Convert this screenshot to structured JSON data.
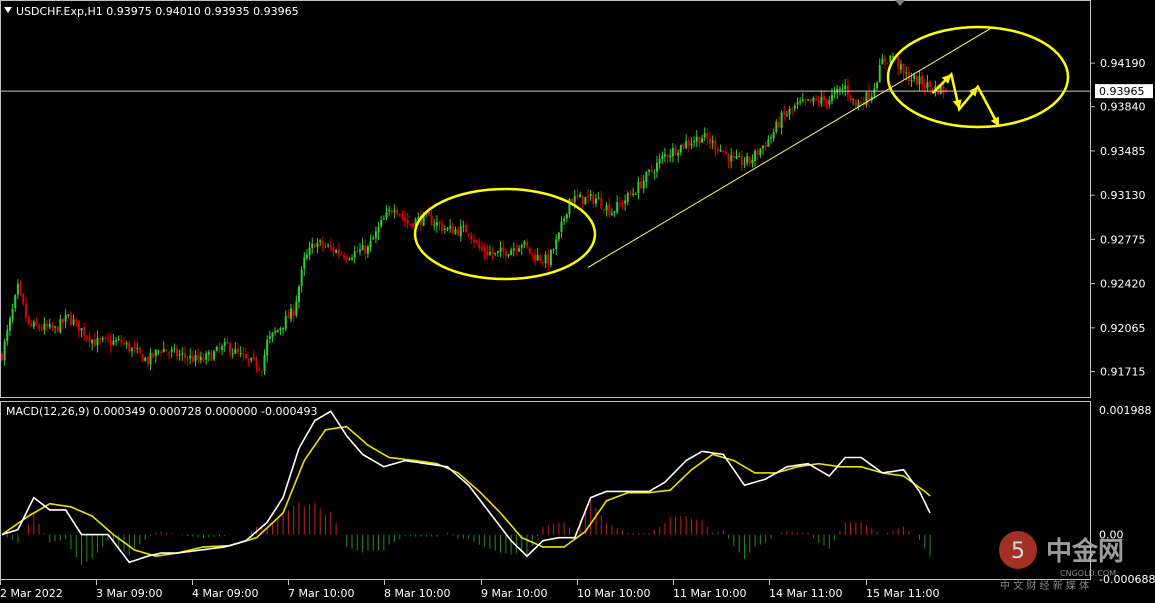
{
  "window": {
    "symbol_line": "USDCHF.Exp,H1  0.93975 0.94010 0.93935 0.93965",
    "menu_icon": "triangle-down-icon"
  },
  "price_panel": {
    "current_price_label": "0.93965",
    "y_ticks": [
      "0.94190",
      "0.93840",
      "0.93485",
      "0.93130",
      "0.92775",
      "0.92420",
      "0.92065",
      "0.91715"
    ]
  },
  "macd_panel": {
    "label": "MACD(12,26,9) 0.000349 0.000728 0.000000 -0.000493",
    "y_ticks": [
      "0.001988",
      "0.00",
      "-0.000688"
    ]
  },
  "x_ticks": [
    "2 Mar 2022",
    "3 Mar 09:00",
    "4 Mar 09:00",
    "7 Mar 10:00",
    "8 Mar 10:00",
    "9 Mar 10:00",
    "10 Mar 10:00",
    "11 Mar 10:00",
    "14 Mar 11:00",
    "15 Mar 11:00"
  ],
  "watermark": {
    "brand_cn": "中金网",
    "brand_en": "CNGOLD.COM",
    "tagline": "中 文 财 经 新 媒 体"
  },
  "colors": {
    "background": "#000000",
    "bull": "#32cd32",
    "bear": "#e00000",
    "macd_main": "#ffffff",
    "macd_signal": "#f0e000",
    "annotation": "#ffff00",
    "grid_border": "#c0c0c0",
    "watermark_red": "#c0392b"
  },
  "chart_data": [
    {
      "type": "candlestick",
      "title": "USDCHF.Exp,H1",
      "timeframe": "H1",
      "last_bar": {
        "open": 0.93975,
        "high": 0.9401,
        "low": 0.93935,
        "close": 0.93965
      },
      "current_price": 0.93965,
      "ylim": [
        0.9155,
        0.9452
      ],
      "y_ticks": [
        0.9419,
        0.9384,
        0.93485,
        0.9313,
        0.92775,
        0.9242,
        0.92065,
        0.91715
      ],
      "x_ticks": [
        "2 Mar 2022",
        "3 Mar 09:00",
        "4 Mar 09:00",
        "7 Mar 10:00",
        "8 Mar 10:00",
        "9 Mar 10:00",
        "10 Mar 10:00",
        "11 Mar 10:00",
        "14 Mar 11:00",
        "15 Mar 11:00"
      ],
      "path_close": [
        [
          0,
          0.9185
        ],
        [
          4,
          0.922
        ],
        [
          6,
          0.9238
        ],
        [
          10,
          0.9208
        ],
        [
          20,
          0.9205
        ],
        [
          25,
          0.9215
        ],
        [
          35,
          0.9195
        ],
        [
          45,
          0.9195
        ],
        [
          55,
          0.918
        ],
        [
          60,
          0.919
        ],
        [
          66,
          0.9185
        ],
        [
          75,
          0.918
        ],
        [
          85,
          0.9192
        ],
        [
          92,
          0.918
        ],
        [
          98,
          0.9175
        ],
        [
          100,
          0.9195
        ],
        [
          104,
          0.9205
        ],
        [
          110,
          0.922
        ],
        [
          114,
          0.926
        ],
        [
          118,
          0.9275
        ],
        [
          130,
          0.9265
        ],
        [
          138,
          0.927
        ],
        [
          143,
          0.929
        ],
        [
          148,
          0.9305
        ],
        [
          153,
          0.929
        ],
        [
          160,
          0.9295
        ],
        [
          168,
          0.9285
        ],
        [
          176,
          0.9285
        ],
        [
          180,
          0.927
        ],
        [
          186,
          0.9265
        ],
        [
          192,
          0.927
        ],
        [
          196,
          0.9275
        ],
        [
          200,
          0.9265
        ],
        [
          206,
          0.926
        ],
        [
          210,
          0.928
        ],
        [
          214,
          0.931
        ],
        [
          224,
          0.931
        ],
        [
          230,
          0.93
        ],
        [
          238,
          0.9315
        ],
        [
          244,
          0.933
        ],
        [
          250,
          0.9345
        ],
        [
          258,
          0.9355
        ],
        [
          264,
          0.936
        ],
        [
          270,
          0.9352
        ],
        [
          276,
          0.934
        ],
        [
          282,
          0.934
        ],
        [
          290,
          0.936
        ],
        [
          294,
          0.9375
        ],
        [
          300,
          0.9385
        ],
        [
          306,
          0.9388
        ],
        [
          312,
          0.939
        ],
        [
          318,
          0.94
        ],
        [
          322,
          0.9385
        ],
        [
          328,
          0.9395
        ],
        [
          332,
          0.942
        ],
        [
          336,
          0.9425
        ],
        [
          340,
          0.941
        ],
        [
          345,
          0.9405
        ],
        [
          350,
          0.94
        ],
        [
          356,
          0.93965
        ]
      ],
      "bars": 357,
      "trendline": {
        "from": [
          221,
          0.9255
        ],
        "to": [
          373,
          0.9447
        ]
      },
      "annotations": {
        "ellipses": 3,
        "projected_path": [
          [
            351,
            0.9395
          ],
          [
            358,
            0.941
          ],
          [
            361,
            0.9382
          ],
          [
            368,
            0.94
          ],
          [
            376,
            0.9368
          ]
        ]
      }
    },
    {
      "type": "macd",
      "label": "MACD(12,26,9)",
      "values": {
        "main": 0.000349,
        "signal": 0.000728,
        "v3": 0.0,
        "v4": -0.000493
      },
      "ylim": [
        -0.000688,
        0.001988
      ],
      "y_ticks": [
        0.001988,
        0.0,
        -0.000688
      ],
      "main_path": [
        [
          0,
          0.0
        ],
        [
          6,
          8e-05
        ],
        [
          12,
          0.0006
        ],
        [
          18,
          0.0004
        ],
        [
          24,
          0.0004
        ],
        [
          30,
          0.0
        ],
        [
          40,
          0.0
        ],
        [
          48,
          -0.00045
        ],
        [
          55,
          -0.00035
        ],
        [
          60,
          -0.0003
        ],
        [
          66,
          -0.0003
        ],
        [
          75,
          -0.00025
        ],
        [
          84,
          -0.0002
        ],
        [
          92,
          -0.0001
        ],
        [
          100,
          0.0002
        ],
        [
          106,
          0.0006
        ],
        [
          112,
          0.0014
        ],
        [
          118,
          0.00185
        ],
        [
          124,
          0.002
        ],
        [
          130,
          0.0016
        ],
        [
          136,
          0.0013
        ],
        [
          144,
          0.0011
        ],
        [
          152,
          0.0012
        ],
        [
          160,
          0.00115
        ],
        [
          168,
          0.0011
        ],
        [
          176,
          0.0008
        ],
        [
          184,
          0.00035
        ],
        [
          192,
          -0.0001
        ],
        [
          198,
          -0.00035
        ],
        [
          204,
          -0.0001
        ],
        [
          210,
          -5e-05
        ],
        [
          216,
          -5e-05
        ],
        [
          222,
          0.0006
        ],
        [
          228,
          0.0007
        ],
        [
          236,
          0.0007
        ],
        [
          244,
          0.0007
        ],
        [
          250,
          0.00085
        ],
        [
          258,
          0.0012
        ],
        [
          264,
          0.00135
        ],
        [
          272,
          0.0013
        ],
        [
          280,
          0.0008
        ],
        [
          288,
          0.0009
        ],
        [
          296,
          0.0011
        ],
        [
          304,
          0.00115
        ],
        [
          312,
          0.00095
        ],
        [
          318,
          0.00125
        ],
        [
          324,
          0.00125
        ],
        [
          332,
          0.001
        ],
        [
          340,
          0.00105
        ],
        [
          346,
          0.0007
        ],
        [
          350,
          0.00035
        ]
      ],
      "signal_path": [
        [
          0,
          0.0
        ],
        [
          10,
          0.0003
        ],
        [
          18,
          0.0005
        ],
        [
          26,
          0.00045
        ],
        [
          34,
          0.0003
        ],
        [
          42,
          0.0
        ],
        [
          50,
          -0.00025
        ],
        [
          58,
          -0.00035
        ],
        [
          66,
          -0.0003
        ],
        [
          76,
          -0.0002
        ],
        [
          86,
          -0.00018
        ],
        [
          96,
          -5e-05
        ],
        [
          106,
          0.00035
        ],
        [
          114,
          0.0012
        ],
        [
          122,
          0.0017
        ],
        [
          130,
          0.00175
        ],
        [
          138,
          0.00145
        ],
        [
          146,
          0.00125
        ],
        [
          156,
          0.0012
        ],
        [
          164,
          0.00115
        ],
        [
          172,
          0.001
        ],
        [
          180,
          0.0007
        ],
        [
          188,
          0.00035
        ],
        [
          196,
          -5e-05
        ],
        [
          204,
          -0.0002
        ],
        [
          212,
          -0.0002
        ],
        [
          220,
          5e-05
        ],
        [
          228,
          0.00055
        ],
        [
          236,
          0.00068
        ],
        [
          244,
          0.00068
        ],
        [
          252,
          0.00072
        ],
        [
          260,
          0.00105
        ],
        [
          268,
          0.0013
        ],
        [
          276,
          0.0012
        ],
        [
          284,
          0.001
        ],
        [
          292,
          0.001
        ],
        [
          300,
          0.0011
        ],
        [
          308,
          0.00115
        ],
        [
          316,
          0.0011
        ],
        [
          324,
          0.0011
        ],
        [
          332,
          0.001
        ],
        [
          340,
          0.00095
        ],
        [
          348,
          0.0007
        ],
        [
          352,
          0.00055
        ]
      ]
    }
  ]
}
